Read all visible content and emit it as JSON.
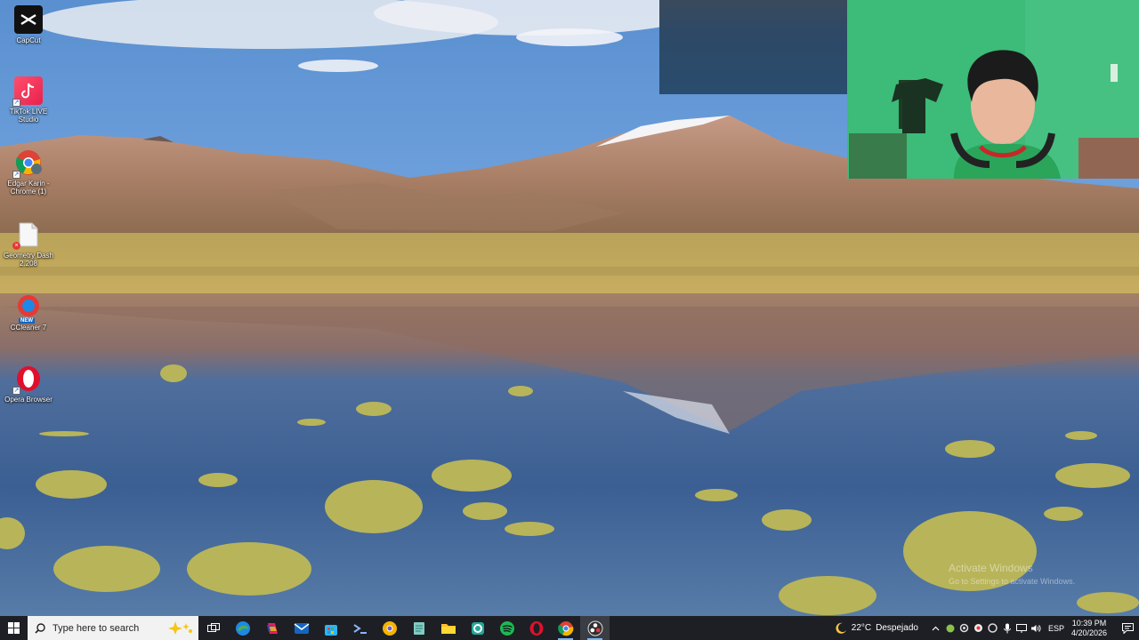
{
  "desktop": {
    "icons": [
      {
        "label": "CapCut",
        "icon": "capcut-icon"
      },
      {
        "label": "TikTok LIVE Studio",
        "icon": "tiktok-live-icon"
      },
      {
        "label": "Edgar Karin - Chrome (1)",
        "icon": "chrome-icon"
      },
      {
        "label": "Geometry Dash 2.208",
        "icon": "document-icon"
      },
      {
        "label": "CCleaner 7",
        "icon": "ccleaner-icon"
      },
      {
        "label": "Opera Browser",
        "icon": "opera-icon"
      }
    ],
    "ccleaner_badge": "NEW"
  },
  "watermark": {
    "title": "Activate Windows",
    "subtitle": "Go to Settings to activate Windows."
  },
  "taskbar": {
    "search_placeholder": "Type here to search",
    "apps": [
      {
        "name": "task-view-icon"
      },
      {
        "name": "edge-icon"
      },
      {
        "name": "copilot-icon"
      },
      {
        "name": "outlook-icon"
      },
      {
        "name": "store-icon"
      },
      {
        "name": "terminal-icon"
      },
      {
        "name": "chrome-canary-icon"
      },
      {
        "name": "notepad-icon"
      },
      {
        "name": "file-explorer-icon"
      },
      {
        "name": "ccleaner-taskbar-icon"
      },
      {
        "name": "spotify-icon"
      },
      {
        "name": "opera-taskbar-icon"
      },
      {
        "name": "chrome-taskbar-icon"
      },
      {
        "name": "obs-icon"
      }
    ],
    "weather": {
      "temperature": "22°C",
      "condition": "Despejado"
    },
    "language": "ESP",
    "time": "10:39 PM",
    "date": "4/20/2026",
    "colors": {
      "background": "#1d1f24",
      "search_bg": "#f2f2f2",
      "accent": "#7ab7f5"
    }
  }
}
